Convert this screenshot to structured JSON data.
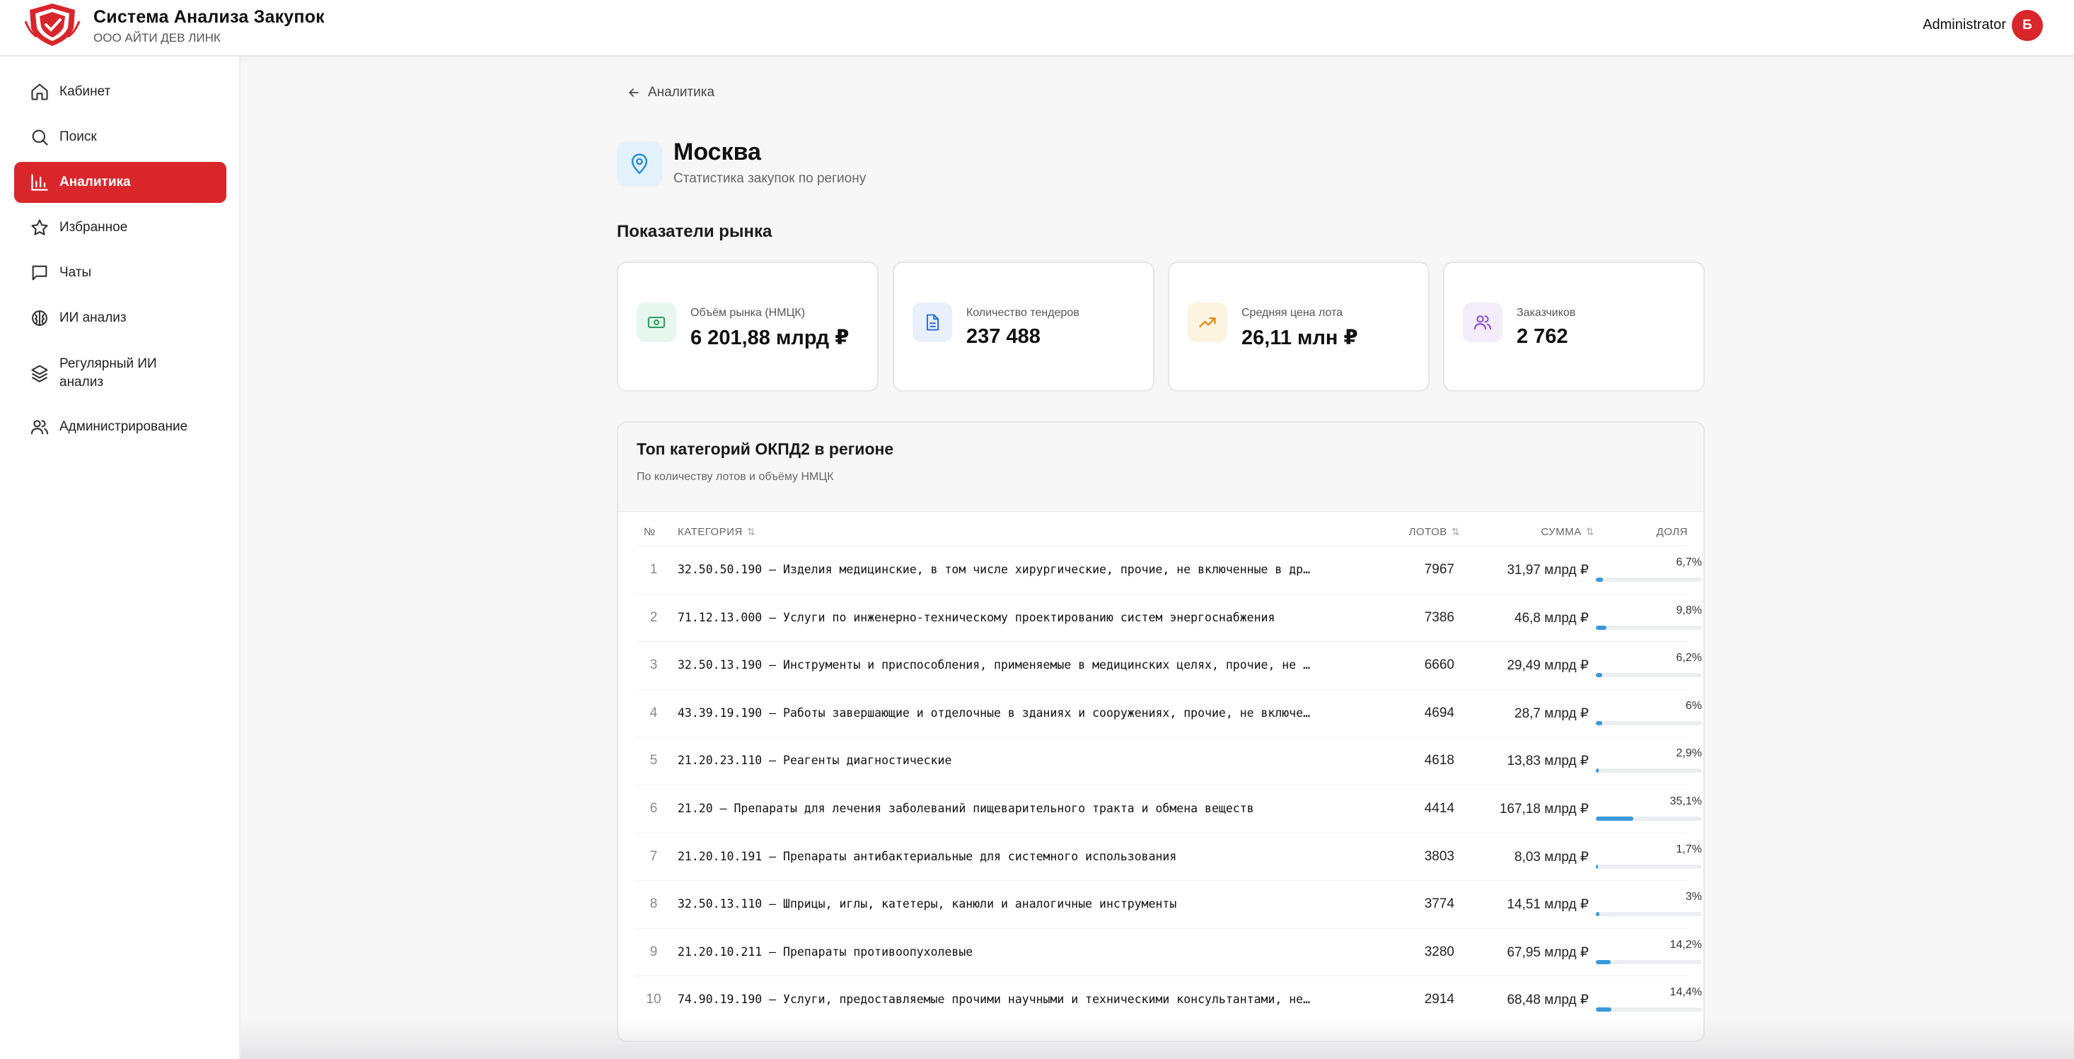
{
  "app": {
    "title": "Система Анализа Закупок",
    "org": "ООО АЙТИ ДЕВ ЛИНК",
    "user_name": "Administrator",
    "user_initial": "Б"
  },
  "colors": {
    "accent": "#d9262b",
    "bar": "#3a9ad9"
  },
  "sidebar": {
    "items": [
      {
        "label": "Кабинет",
        "icon": "home-icon"
      },
      {
        "label": "Поиск",
        "icon": "search-icon"
      },
      {
        "label": "Аналитика",
        "icon": "bar-chart-icon",
        "active": true
      },
      {
        "label": "Избранное",
        "icon": "star-icon"
      },
      {
        "label": "Чаты",
        "icon": "chat-icon"
      },
      {
        "label": "ИИ анализ",
        "icon": "brain-icon"
      },
      {
        "label": "Регулярный ИИ анализ",
        "icon": "layers-icon"
      },
      {
        "label": "Администрирование",
        "icon": "users-icon"
      }
    ]
  },
  "breadcrumb": {
    "back_label": "Аналитика"
  },
  "region": {
    "title": "Москва",
    "subtitle": "Статистика закупок по региону"
  },
  "market": {
    "title": "Показатели рынка",
    "cards": [
      {
        "label": "Объём рынка (НМЦК)",
        "value": "6 201,88 млрд ₽",
        "icon": "money-icon"
      },
      {
        "label": "Количество тендеров",
        "value": "237 488",
        "icon": "document-icon"
      },
      {
        "label": "Средняя цена лота",
        "value": "26,11 млн ₽",
        "icon": "trend-up-icon"
      },
      {
        "label": "Заказчиков",
        "value": "2 762",
        "icon": "users-icon"
      }
    ]
  },
  "categories": {
    "title": "Топ категорий ОКПД2 в регионе",
    "subtitle": "По количеству лотов и объёму НМЦК",
    "columns": {
      "num": "№",
      "category": "КАТЕГОРИЯ",
      "lots": "ЛОТОВ",
      "sum": "СУММА",
      "share": "ДОЛЯ"
    },
    "rows": [
      {
        "num": "1",
        "category": "32.50.50.190 — Изделия медицинские, в том числе хирургические, прочие, не включенные в др…",
        "lots": "7967",
        "sum": "31,97 млрд ₽",
        "share": "6,7%",
        "share_value": 6.7
      },
      {
        "num": "2",
        "category": "71.12.13.000 — Услуги по инженерно-техническому проектированию систем энергоснабжения",
        "lots": "7386",
        "sum": "46,8 млрд ₽",
        "share": "9,8%",
        "share_value": 9.8
      },
      {
        "num": "3",
        "category": "32.50.13.190 — Инструменты и приспособления, применяемые в медицинских целях, прочие, не …",
        "lots": "6660",
        "sum": "29,49 млрд ₽",
        "share": "6,2%",
        "share_value": 6.2
      },
      {
        "num": "4",
        "category": "43.39.19.190 — Работы завершающие и отделочные в зданиях и сооружениях, прочие, не включе…",
        "lots": "4694",
        "sum": "28,7 млрд ₽",
        "share": "6%",
        "share_value": 6
      },
      {
        "num": "5",
        "category": "21.20.23.110 — Реагенты диагностические",
        "lots": "4618",
        "sum": "13,83 млрд ₽",
        "share": "2,9%",
        "share_value": 2.9
      },
      {
        "num": "6",
        "category": "21.20 — Препараты для лечения заболеваний пищеварительного тракта и обмена веществ",
        "lots": "4414",
        "sum": "167,18 млрд ₽",
        "share": "35,1%",
        "share_value": 35.1
      },
      {
        "num": "7",
        "category": "21.20.10.191 — Препараты антибактериальные для системного использования",
        "lots": "3803",
        "sum": "8,03 млрд ₽",
        "share": "1,7%",
        "share_value": 1.7
      },
      {
        "num": "8",
        "category": "32.50.13.110 — Шприцы, иглы, катетеры, канюли и аналогичные инструменты",
        "lots": "3774",
        "sum": "14,51 млрд ₽",
        "share": "3%",
        "share_value": 3
      },
      {
        "num": "9",
        "category": "21.20.10.211 — Препараты противоопухолевые",
        "lots": "3280",
        "sum": "67,95 млрд ₽",
        "share": "14,2%",
        "share_value": 14.2
      },
      {
        "num": "10",
        "category": "74.90.19.190 — Услуги, предоставляемые прочими научными и техническими консультантами, не…",
        "lots": "2914",
        "sum": "68,48 млрд ₽",
        "share": "14,4%",
        "share_value": 14.4
      }
    ]
  }
}
